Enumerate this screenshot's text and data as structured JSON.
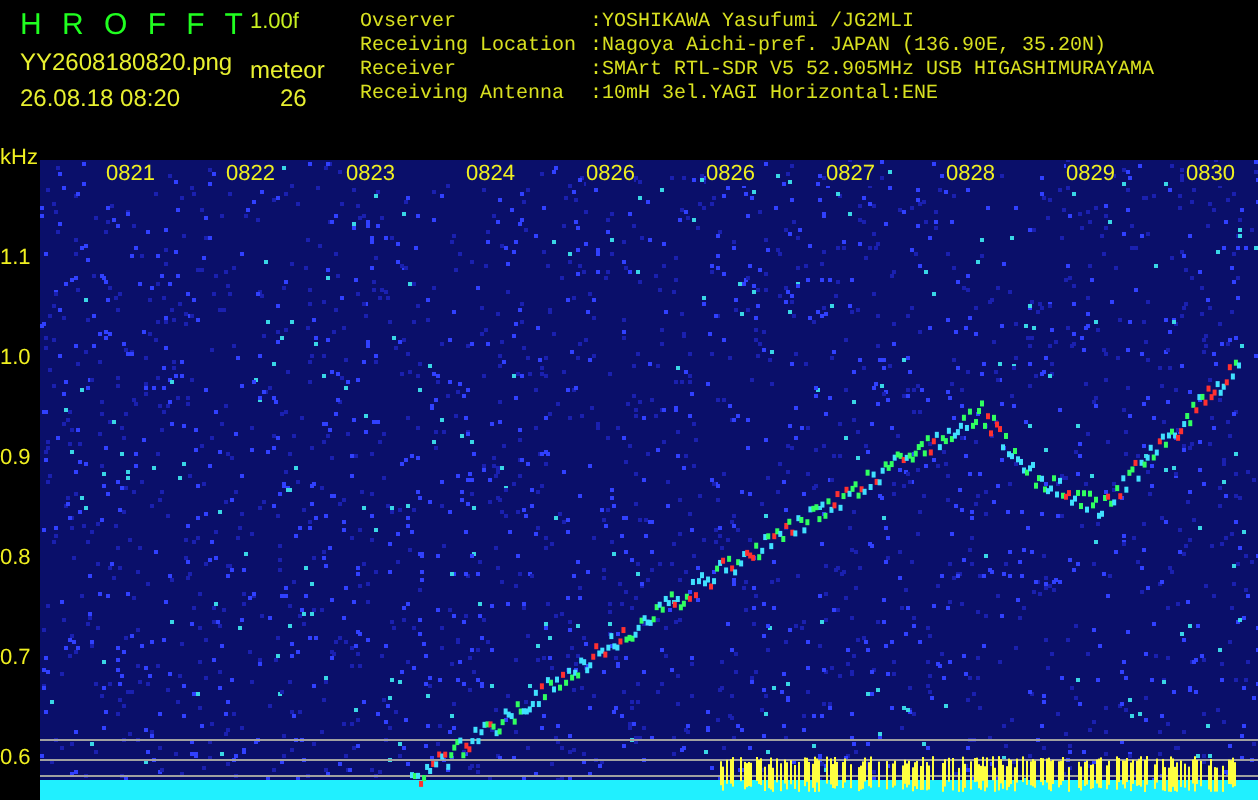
{
  "header": {
    "title": "H R O F F T",
    "version": "1.00f",
    "filename": "YY2608180820.png",
    "datetime": "26.08.18 08:20",
    "mode": "meteor",
    "count": "26"
  },
  "info": [
    {
      "label": "Ovserver",
      "value": ":YOSHIKAWA Yasufumi /JG2MLI"
    },
    {
      "label": "Receiving Location",
      "value": ":Nagoya Aichi-pref. JAPAN (136.90E, 35.20N)"
    },
    {
      "label": "Receiver",
      "value": ":SMArt RTL-SDR V5 52.905MHz USB HIGASHIMURAYAMA"
    },
    {
      "label": "Receiving Antenna",
      "value": ":10mH 3el.YAGI Horizontal:ENE"
    }
  ],
  "freq_axis": {
    "unit": "kHz",
    "labels": [
      "1.1",
      "1.0",
      "0.9",
      "0.8",
      "0.7",
      "0.6"
    ]
  },
  "time_labels": [
    "0821",
    "0822",
    "0823",
    "0824",
    "0826",
    "0826",
    "0827",
    "0828",
    "0829",
    "0830"
  ]
}
